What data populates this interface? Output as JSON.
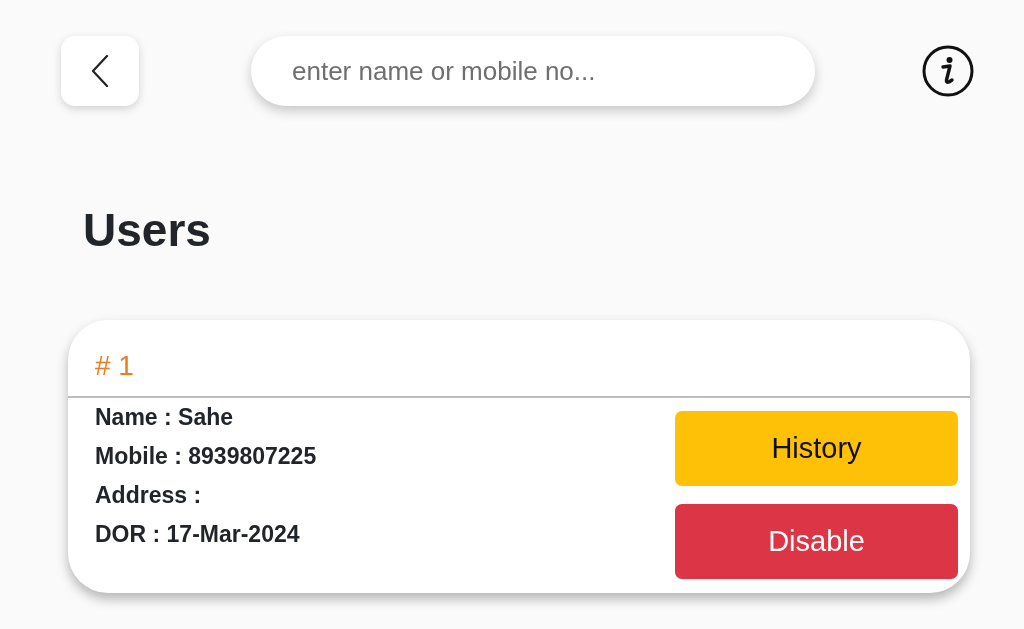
{
  "header": {
    "search": {
      "placeholder": "enter name or mobile no..."
    }
  },
  "title": "Users",
  "users": [
    {
      "number": "# 1",
      "fields": [
        "Name : Sahe",
        "Mobile : 8939807225",
        "Address :",
        "DOR : 17-Mar-2024"
      ],
      "actions": [
        {
          "label": "History",
          "kind": "warning"
        },
        {
          "label": "Disable",
          "kind": "danger"
        }
      ]
    }
  ]
}
